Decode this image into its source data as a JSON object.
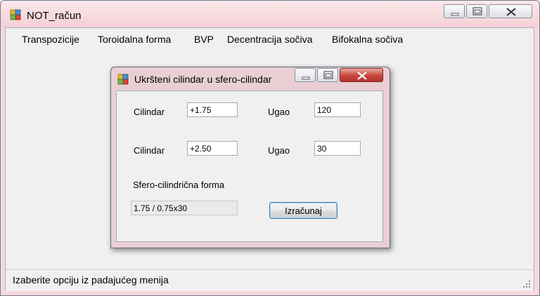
{
  "main_window": {
    "title": "NOT_račun",
    "menu": [
      "Transpozicije",
      "Toroidalna forma",
      "BVP",
      "Decentracija sočiva",
      "Bifokalna sočiva"
    ],
    "status": "Izaberite opciju iz padajućeg menija"
  },
  "dialog": {
    "title": "Ukršteni cilindar u sfero-cilindar",
    "row1": {
      "cylinder_label": "Cilindar",
      "cylinder_value": "+1.75",
      "angle_label": "Ugao",
      "angle_value": "120"
    },
    "row2": {
      "cylinder_label": "Cilindar",
      "cylinder_value": "+2.50",
      "angle_label": "Ugao",
      "angle_value": "30"
    },
    "result_label": "Sfero-cilindrična forma",
    "result_value": "1.75 / 0.75x30",
    "calculate_button": "Izračunaj"
  },
  "colors": {
    "title_bar": "#f7d9dd",
    "close_button": "#c9463d",
    "client_bg": "#f0f0f0",
    "button_border": "#3c7fb1"
  }
}
